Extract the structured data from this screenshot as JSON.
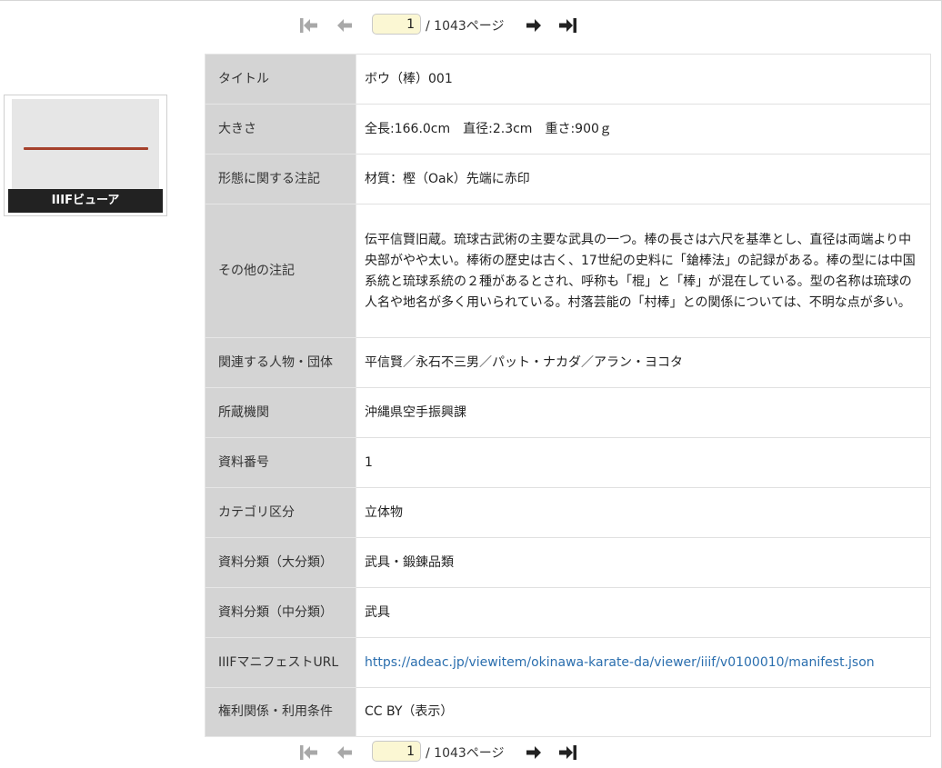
{
  "pager": {
    "current_page": "1",
    "total_label": "/ 1043ページ"
  },
  "thumbnail": {
    "label": "IIIFビューア"
  },
  "metadata": [
    {
      "label": "タイトル",
      "value": "ボウ（棒）001"
    },
    {
      "label": "大きさ",
      "value": "全長:166.0cm　直径:2.3cm　重さ:900ｇ"
    },
    {
      "label": "形態に関する注記",
      "value": "材質：樫（Oak）先端に赤印"
    },
    {
      "label": "その他の注記",
      "value": "伝平信賢旧蔵。琉球古武術の主要な武具の一つ。棒の長さは六尺を基準とし、直径は両端より中央部がやや太い。棒術の歴史は古く、17世紀の史料に「鎗棒法」の記録がある。棒の型には中国系統と琉球系統の２種があるとされ、呼称も「棍」と「棒」が混在している。型の名称は琉球の人名や地名が多く用いられている。村落芸能の「村棒」との関係については、不明な点が多い。"
    },
    {
      "label": "関連する人物・団体",
      "value": "平信賢／永石不三男／パット・ナカダ／アラン・ヨコタ"
    },
    {
      "label": "所蔵機関",
      "value": "沖縄県空手振興課"
    },
    {
      "label": "資料番号",
      "value": "1"
    },
    {
      "label": "カテゴリ区分",
      "value": "立体物"
    },
    {
      "label": "資料分類（大分類）",
      "value": "武具・鍛錬品類"
    },
    {
      "label": "資料分類（中分類）",
      "value": "武具"
    },
    {
      "label": "IIIFマニフェストURL",
      "value": "https://adeac.jp/viewitem/okinawa-karate-da/viewer/iiif/v0100010/manifest.json"
    },
    {
      "label": "権利関係・利用条件",
      "value": "CC BY（表示）"
    }
  ],
  "colors": {
    "label_bg": "#d4d4d4",
    "link": "#2a6eae",
    "page_input_bg": "#fbf7d3",
    "icon": "#333333",
    "icon_disabled": "#a8a8a8"
  },
  "icons": {
    "first": "first-page-icon",
    "prev": "prev-page-icon",
    "next": "next-page-icon",
    "last": "last-page-icon"
  }
}
